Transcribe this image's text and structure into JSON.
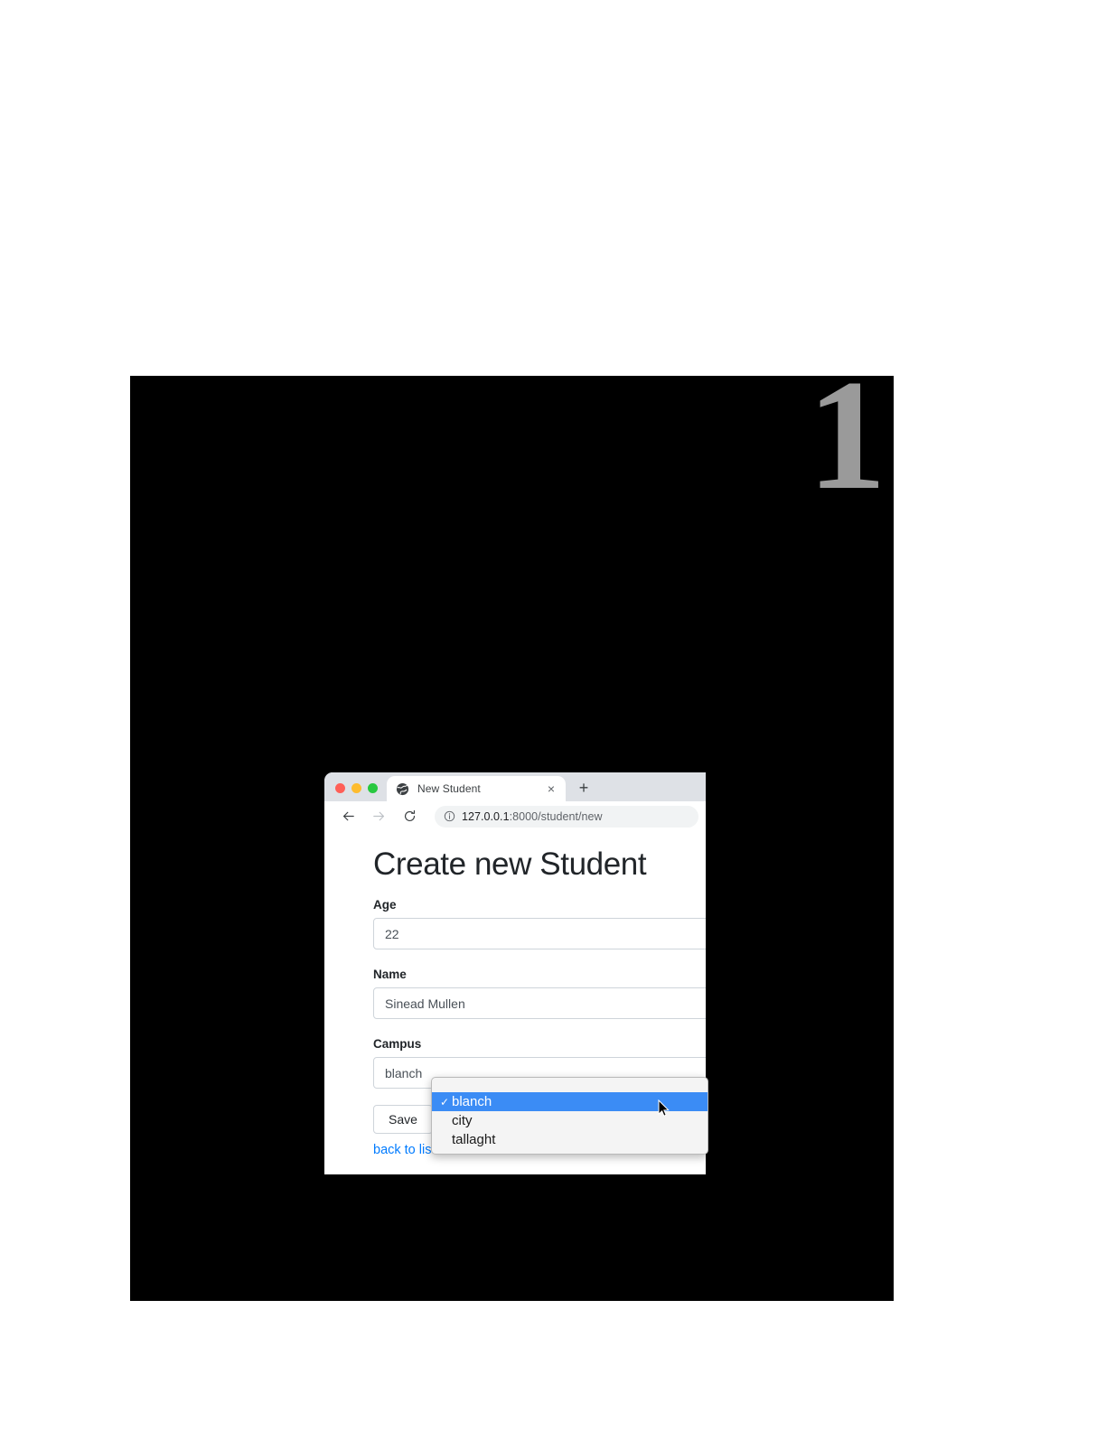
{
  "slide": {
    "number": "1",
    "number_color": "#9a9a9a",
    "backdrop_color": "#000000"
  },
  "browser": {
    "traffic_lights": {
      "close_color": "#ff5f57",
      "minimize_color": "#febc2e",
      "zoom_color": "#28c840"
    },
    "tab": {
      "title": "New Student",
      "favicon_name": "globe-icon",
      "close_glyph": "×"
    },
    "new_tab_glyph": "+",
    "toolbar": {
      "back_name": "back-arrow-icon",
      "forward_name": "forward-arrow-icon",
      "reload_name": "reload-icon",
      "info_name": "info-circle-icon",
      "url_host": "127.0.0.1",
      "url_path": ":8000/student/new"
    }
  },
  "page": {
    "heading": "Create new Student",
    "fields": [
      {
        "label": "Age",
        "value": "22",
        "name": "age"
      },
      {
        "label": "Name",
        "value": "Sinead Mullen",
        "name": "name"
      }
    ],
    "campus": {
      "label": "Campus",
      "value": "blanch"
    },
    "save_label": "Save",
    "back_link_label": "back to list",
    "link_color": "#007bff"
  },
  "select_popup": {
    "highlight_color": "#3b8cf5",
    "check_glyph": "✓",
    "options": [
      {
        "label": "blanch",
        "selected": true
      },
      {
        "label": "city",
        "selected": false
      },
      {
        "label": "tallaght",
        "selected": false
      }
    ]
  }
}
